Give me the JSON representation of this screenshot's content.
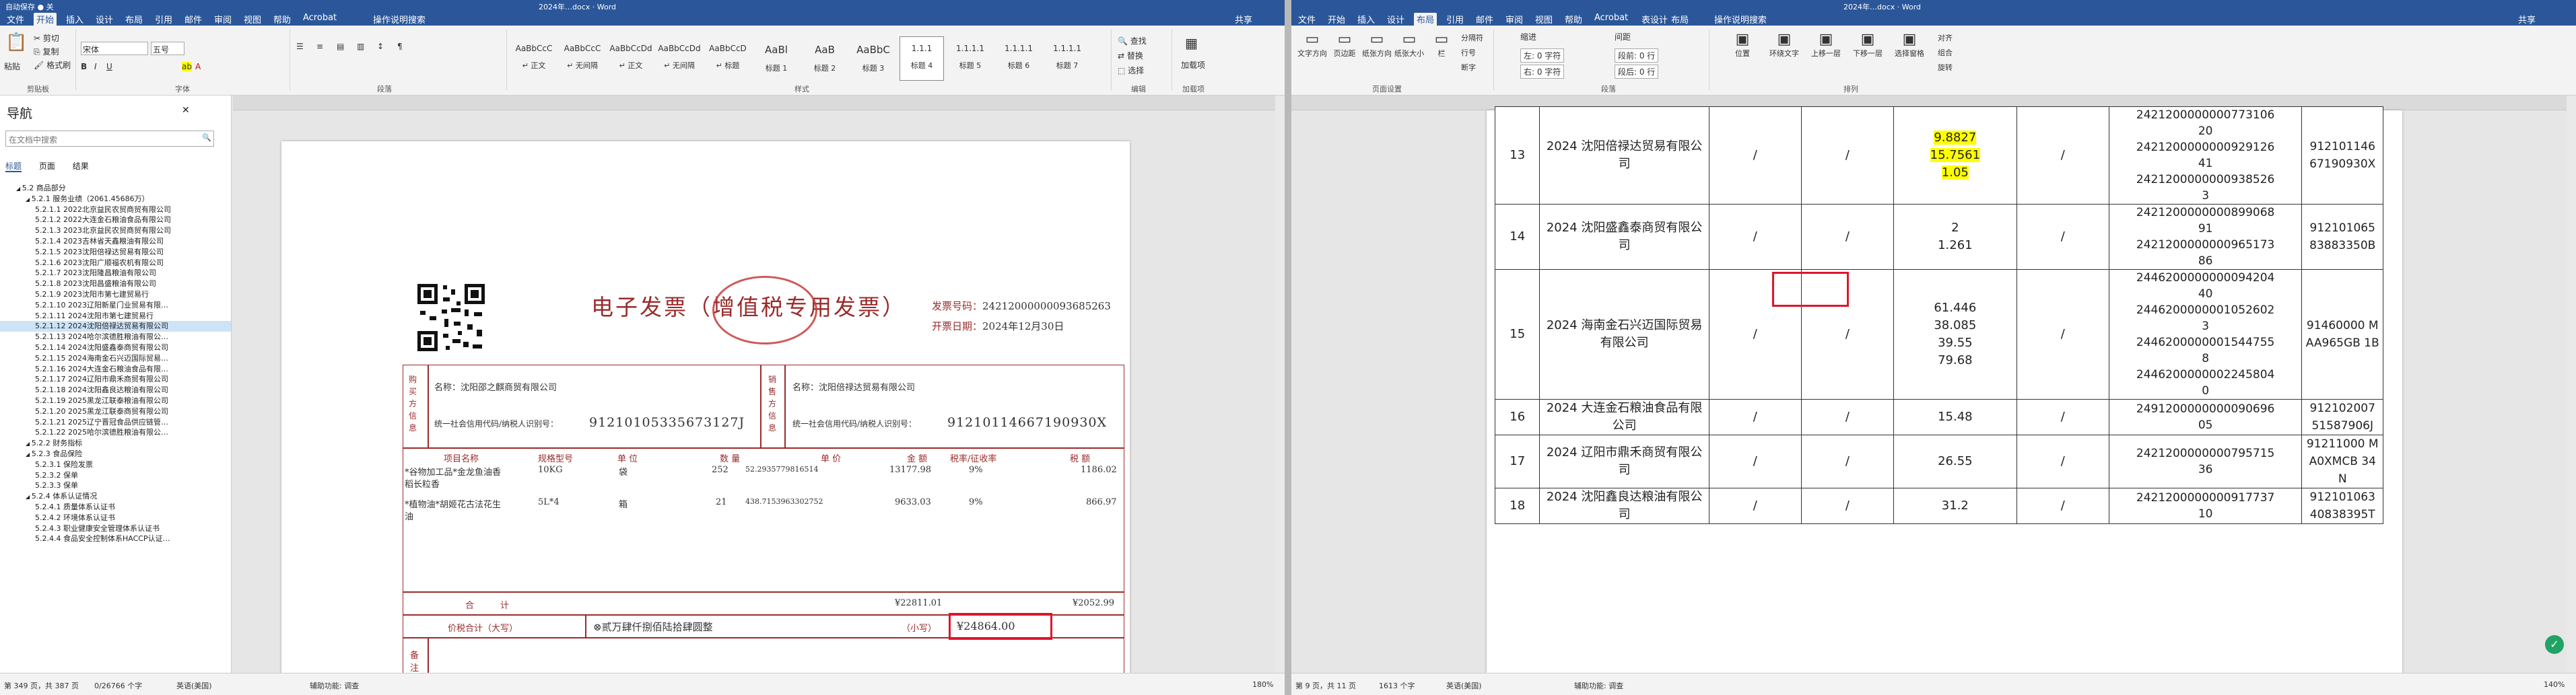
{
  "left": {
    "titlebar": {
      "quick": "自动保存 ● 关",
      "doc": "2024年…docx · Word",
      "search": "搜索"
    },
    "tabs": [
      "文件",
      "开始",
      "插入",
      "设计",
      "布局",
      "引用",
      "邮件",
      "审阅",
      "视图",
      "帮助",
      "Acrobat"
    ],
    "active_tab": "开始",
    "tell_me": "操作说明搜索",
    "share": "共享",
    "ribbon": {
      "clipboard": {
        "paste": "粘贴",
        "cut": "剪切",
        "copy": "复制",
        "painter": "格式刷",
        "label": "剪贴板"
      },
      "font": {
        "name": "宋体",
        "size": "五号",
        "label": "字体"
      },
      "paragraph_label": "段落",
      "styles": [
        {
          "preview": "AaBbCcC",
          "name": "↵ 正文"
        },
        {
          "preview": "AaBbCcC",
          "name": "↵ 无间隔"
        },
        {
          "preview": "AaBbCcDd",
          "name": "↵ 正文"
        },
        {
          "preview": "AaBbCcDd",
          "name": "↵ 无间隔"
        },
        {
          "preview": "AaBbCcD",
          "name": "↵ 标题"
        },
        {
          "preview": "AaBl",
          "name": "标题 1"
        },
        {
          "preview": "AaB",
          "name": "标题 2"
        },
        {
          "preview": "AaBbC",
          "name": "标题 3"
        },
        {
          "preview": "1.1.1",
          "name": "标题 4"
        },
        {
          "preview": "1.1.1.1",
          "name": "标题 5"
        },
        {
          "preview": "1.1.1.1",
          "name": "标题 6"
        },
        {
          "preview": "1.1.1.1",
          "name": "标题 7"
        }
      ],
      "styles_label": "样式",
      "editing": {
        "find": "查找",
        "replace": "替换",
        "select": "选择",
        "label": "编辑"
      },
      "addins": {
        "label": "加载项",
        "btn": "加载项"
      }
    },
    "nav": {
      "title": "导航",
      "search_placeholder": "在文档中搜索",
      "tabs": [
        "标题",
        "页面",
        "结果"
      ],
      "items": [
        {
          "text": "5.2 商品部分",
          "indent": 1
        },
        {
          "text": "5.2.1 服务业绩（2061.45686万）",
          "indent": 2
        },
        {
          "text": "5.2.1.1 2022北京益民农贸商贸有限公司",
          "indent": 3
        },
        {
          "text": "5.2.1.2 2022大连金石粮油食品有限公司",
          "indent": 3
        },
        {
          "text": "5.2.1.3 2023北京益民农贸商贸有限公司",
          "indent": 3
        },
        {
          "text": "5.2.1.4 2023吉林省天鑫粮油有限公司",
          "indent": 3
        },
        {
          "text": "5.2.1.5 2023沈阳倍禄达贸易有限公司",
          "indent": 3
        },
        {
          "text": "5.2.1.6 2023沈阳广顺福农机有限公司",
          "indent": 3
        },
        {
          "text": "5.2.1.7 2023沈阳隆昌粮油有限公司",
          "indent": 3
        },
        {
          "text": "5.2.1.8 2023沈阳昌盛粮油有限公司",
          "indent": 3
        },
        {
          "text": "5.2.1.9 2023沈阳市第七建贸易行",
          "indent": 3
        },
        {
          "text": "5.2.1.10 2023辽阳新星门业贸易有限…",
          "indent": 3
        },
        {
          "text": "5.2.1.11 2024沈阳市第七建贸易行",
          "indent": 3
        },
        {
          "text": "5.2.1.12 2024沈阳倍禄达贸易有限公司",
          "indent": 3,
          "selected": true
        },
        {
          "text": "5.2.1.13 2024哈尔滨德胜粮油有限公…",
          "indent": 3
        },
        {
          "text": "5.2.1.14 2024沈阳盛鑫泰商贸有限公司",
          "indent": 3
        },
        {
          "text": "5.2.1.15 2024海南金石兴迈国际贸易…",
          "indent": 3
        },
        {
          "text": "5.2.1.16 2024大连金石粮油食品有限…",
          "indent": 3
        },
        {
          "text": "5.2.1.17 2024辽阳市鼎禾商贸有限公司",
          "indent": 3
        },
        {
          "text": "5.2.1.18 2024沈阳鑫良达粮油有限公司",
          "indent": 3
        },
        {
          "text": "5.2.1.19 2025黑龙江联泰粮油有限公司",
          "indent": 3
        },
        {
          "text": "5.2.1.20 2025黑龙江联泰商贸有限公司",
          "indent": 3
        },
        {
          "text": "5.2.1.21 2025辽宁晋冠食品供应链管…",
          "indent": 3
        },
        {
          "text": "5.2.1.22 2025哈尔滨德胜粮油有限公…",
          "indent": 3
        },
        {
          "text": "5.2.2 财务指标",
          "indent": 2
        },
        {
          "text": "5.2.3 食品保险",
          "indent": 2
        },
        {
          "text": "5.2.3.1 保险发票",
          "indent": 3
        },
        {
          "text": "5.2.3.2 保单",
          "indent": 3
        },
        {
          "text": "5.2.3.3 保单",
          "indent": 3
        },
        {
          "text": "5.2.4 体系认证情况",
          "indent": 2
        },
        {
          "text": "5.2.4.1 质量体系认证书",
          "indent": 3
        },
        {
          "text": "5.2.4.2 环境体系认证书",
          "indent": 3
        },
        {
          "text": "5.2.4.3 职业健康安全管理体系认证书",
          "indent": 3
        },
        {
          "text": "5.2.4.4 食品安全控制体系HACCP认证…",
          "indent": 3
        }
      ]
    },
    "invoice": {
      "title": "电子发票（增值税专用发票）",
      "no_label": "发票号码：",
      "no": "24212000000093685263",
      "date_label": "开票日期：",
      "date": "2024年12月30日",
      "buyer_side": "购买方信息",
      "seller_side": "销售方信息",
      "buyer_name": "名称：沈阳邵之麒商贸有限公司",
      "buyer_tax_label": "统一社会信用代码/纳税人识别号：",
      "buyer_tax": "91210105335673127J",
      "seller_name": "名称：沈阳倍禄达贸易有限公司",
      "seller_tax_label": "统一社会信用代码/纳税人识别号：",
      "seller_tax": "91210114667190930X",
      "cols": [
        "项目名称",
        "规格型号",
        "单 位",
        "数 量",
        "单 价",
        "金 额",
        "税率/征收率",
        "税 额"
      ],
      "rows": [
        {
          "name": "*谷物加工品*金龙鱼油香",
          "name2": "稻长粒香",
          "spec": "10KG",
          "unit": "袋",
          "qty": "252",
          "price": "52.2935779816514",
          "amount": "13177.98",
          "rate": "9%",
          "tax": "1186.02"
        },
        {
          "name": "*植物油*胡姬花古法花生",
          "name2": "油",
          "spec": "5L*4",
          "unit": "箱",
          "qty": "21",
          "price": "438.7153963302752",
          "amount": "9633.03",
          "rate": "9%",
          "tax": "866.97"
        }
      ],
      "total_label": "合　　　计",
      "total_amount": "¥22811.01",
      "total_tax": "¥2052.99",
      "grand_label": "价税合计（大写）",
      "grand_words": "贰万肆仟捌佰陆拾肆圆整",
      "grand_small_label": "（小写）",
      "grand": "¥24864.00",
      "remark_label": "备注"
    },
    "status": {
      "page": "第 349 页，共 387 页",
      "words": "0/26766 个字",
      "lang": "英语(美国)",
      "track": "辅助功能: 调查",
      "zoom": "180%"
    }
  },
  "right": {
    "titlebar": {
      "doc": "2024年…docx · Word",
      "share": "共享"
    },
    "tabs": [
      "文件",
      "开始",
      "插入",
      "设计",
      "布局",
      "引用",
      "邮件",
      "审阅",
      "视图",
      "帮助",
      "Acrobat",
      "表设计",
      "布局"
    ],
    "active_tab": "布局",
    "tell_me": "操作说明搜索",
    "ribbon": {
      "page_setup": [
        "文字方向",
        "页边距",
        "纸张方向",
        "纸张大小",
        "栏"
      ],
      "breaks": [
        "分隔符",
        "行号",
        "断字"
      ],
      "page_setup_label": "页面设置",
      "indent_label": "缩进",
      "spacing_label": "间距",
      "left": "左: 0 字符",
      "right": "右: 0 字符",
      "before": "段前: 0 行",
      "after": "段后: 0 行",
      "paragraph_label": "段落",
      "arrange": [
        "位置",
        "环绕文字",
        "上移一层",
        "下移一层",
        "选择窗格",
        "对齐",
        "组合",
        "旋转"
      ],
      "arrange_label": "排列"
    },
    "table": [
      {
        "no": "13",
        "name": "2024 沈阳倍禄达贸易有限公司",
        "c3": "/",
        "c4": "/",
        "vals": [
          "9.8827",
          "15.7561",
          "1.05"
        ],
        "c6": "/",
        "invoices": [
          "2421200000000773106",
          "20",
          "2421200000000929126",
          "41",
          "2421200000000938526",
          "3"
        ],
        "tax": "912101146 67190930X"
      },
      {
        "no": "14",
        "name": "2024 沈阳盛鑫泰商贸有限公司",
        "c3": "/",
        "c4": "/",
        "vals": [
          "2",
          "1.261"
        ],
        "c6": "/",
        "invoices": [
          "2421200000000899068",
          "91",
          "2421200000000965173",
          "86"
        ],
        "tax": "912101065 83883350B"
      },
      {
        "no": "15",
        "name": "2024 海南金石兴迈国际贸易有限公司",
        "c3": "/",
        "c4": "/",
        "vals": [
          "61.446",
          "38.085",
          "39.55",
          "79.68"
        ],
        "c6": "/",
        "invoices": [
          "2446200000000094204",
          "40",
          "2446200000001052602",
          "3",
          "2446200000001544755",
          "8",
          "2446200000002245804",
          "0"
        ],
        "tax": "91460000 MAA965GB 1B"
      },
      {
        "no": "16",
        "name": "2024 大连金石粮油食品有限公司",
        "c3": "/",
        "c4": "/",
        "vals": [
          "15.48"
        ],
        "c6": "/",
        "invoices": [
          "2491200000000090696",
          "05"
        ],
        "tax": "912102007 51587906J"
      },
      {
        "no": "17",
        "name": "2024 辽阳市鼎禾商贸有限公司",
        "c3": "/",
        "c4": "/",
        "vals": [
          "26.55"
        ],
        "c6": "/",
        "invoices": [
          "2421200000000795715",
          "36"
        ],
        "tax": "91211000 MA0XMCB 34N"
      },
      {
        "no": "18",
        "name": "2024 沈阳鑫良达粮油有限公司",
        "c3": "/",
        "c4": "/",
        "vals": [
          "31.2"
        ],
        "c6": "/",
        "invoices": [
          "2421200000000917737",
          "10"
        ],
        "tax": "912101063 40838395T"
      }
    ],
    "status": {
      "page": "第 9 页，共 11 页",
      "words": "1613 个字",
      "lang": "英语(美国)",
      "track": "辅助功能: 调查",
      "zoom": "140%"
    }
  },
  "colors": {
    "word_blue": "#2b579a",
    "invoice_red": "#9a2b2b",
    "highlight": "#ffff00",
    "mark_red": "#e0142c"
  }
}
